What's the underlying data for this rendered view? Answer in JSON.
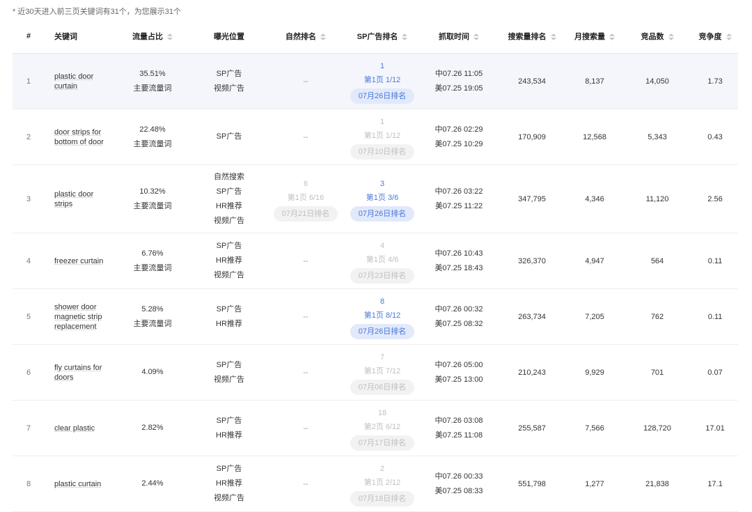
{
  "notice": "* 近30天进入前三页关键词有31个，为您展示31个",
  "headers": {
    "index": "#",
    "keyword": "关键词",
    "traffic": "流量占比",
    "exposure": "曝光位置",
    "natural": "自然排名",
    "sp": "SP广告排名",
    "time": "抓取时间",
    "search_rank": "搜索量排名",
    "monthly": "月搜索量",
    "competitors": "竞品数",
    "competition": "竞争度"
  },
  "rows": [
    {
      "index": "1",
      "keyword": "plastic door curtain",
      "traffic": "35.51%",
      "traffic_tag": "主要流量词",
      "exposure": [
        "SP广告",
        "视频广告"
      ],
      "natural": {
        "num": "--",
        "page": "",
        "badge": ""
      },
      "sp": {
        "num": "1",
        "page": "第1页 1/12",
        "badge": "07月26日排名",
        "active": true
      },
      "time_cn": "中07.26 11:05",
      "time_us": "美07.25 19:05",
      "search_rank": "243,534",
      "monthly": "8,137",
      "competitors": "14,050",
      "competition": "1.73"
    },
    {
      "index": "2",
      "keyword": "door strips for bottom of door",
      "traffic": "22.48%",
      "traffic_tag": "主要流量词",
      "exposure": [
        "SP广告"
      ],
      "natural": {
        "num": "--",
        "page": "",
        "badge": ""
      },
      "sp": {
        "num": "1",
        "page": "第1页 1/12",
        "badge": "07月10日排名",
        "active": false
      },
      "time_cn": "中07.26 02:29",
      "time_us": "美07.25 10:29",
      "search_rank": "170,909",
      "monthly": "12,568",
      "competitors": "5,343",
      "competition": "0.43"
    },
    {
      "index": "3",
      "keyword": "plastic door strips",
      "traffic": "10.32%",
      "traffic_tag": "主要流量词",
      "exposure": [
        "自然搜索",
        "SP广告",
        "HR推荐",
        "视频广告"
      ],
      "natural": {
        "num": "6",
        "page": "第1页 6/16",
        "badge": "07月21日排名",
        "active": false
      },
      "sp": {
        "num": "3",
        "page": "第1页 3/6",
        "badge": "07月26日排名",
        "active": true
      },
      "time_cn": "中07.26 03:22",
      "time_us": "美07.25 11:22",
      "search_rank": "347,795",
      "monthly": "4,346",
      "competitors": "11,120",
      "competition": "2.56"
    },
    {
      "index": "4",
      "keyword": "freezer curtain",
      "traffic": "6.76%",
      "traffic_tag": "主要流量词",
      "exposure": [
        "SP广告",
        "HR推荐",
        "视频广告"
      ],
      "natural": {
        "num": "--",
        "page": "",
        "badge": ""
      },
      "sp": {
        "num": "4",
        "page": "第1页 4/6",
        "badge": "07月23日排名",
        "active": false
      },
      "time_cn": "中07.26 10:43",
      "time_us": "美07.25 18:43",
      "search_rank": "326,370",
      "monthly": "4,947",
      "competitors": "564",
      "competition": "0.11"
    },
    {
      "index": "5",
      "keyword": "shower door magnetic strip replacement",
      "traffic": "5.28%",
      "traffic_tag": "主要流量词",
      "exposure": [
        "SP广告",
        "HR推荐"
      ],
      "natural": {
        "num": "--",
        "page": "",
        "badge": ""
      },
      "sp": {
        "num": "8",
        "page": "第1页 8/12",
        "badge": "07月26日排名",
        "active": true
      },
      "time_cn": "中07.26 00:32",
      "time_us": "美07.25 08:32",
      "search_rank": "263,734",
      "monthly": "7,205",
      "competitors": "762",
      "competition": "0.11"
    },
    {
      "index": "6",
      "keyword": "fly curtains for doors",
      "traffic": "4.09%",
      "traffic_tag": "",
      "exposure": [
        "SP广告",
        "视频广告"
      ],
      "natural": {
        "num": "--",
        "page": "",
        "badge": ""
      },
      "sp": {
        "num": "7",
        "page": "第1页 7/12",
        "badge": "07月06日排名",
        "active": false
      },
      "time_cn": "中07.26 05:00",
      "time_us": "美07.25 13:00",
      "search_rank": "210,243",
      "monthly": "9,929",
      "competitors": "701",
      "competition": "0.07"
    },
    {
      "index": "7",
      "keyword": "clear plastic",
      "traffic": "2.82%",
      "traffic_tag": "",
      "exposure": [
        "SP广告",
        "HR推荐"
      ],
      "natural": {
        "num": "--",
        "page": "",
        "badge": ""
      },
      "sp": {
        "num": "18",
        "page": "第2页 6/12",
        "badge": "07月17日排名",
        "active": false
      },
      "time_cn": "中07.26 03:08",
      "time_us": "美07.25 11:08",
      "search_rank": "255,587",
      "monthly": "7,566",
      "competitors": "128,720",
      "competition": "17.01"
    },
    {
      "index": "8",
      "keyword": "plastic curtain",
      "traffic": "2.44%",
      "traffic_tag": "",
      "exposure": [
        "SP广告",
        "HR推荐",
        "视频广告"
      ],
      "natural": {
        "num": "--",
        "page": "",
        "badge": ""
      },
      "sp": {
        "num": "2",
        "page": "第1页 2/12",
        "badge": "07月18日排名",
        "active": false
      },
      "time_cn": "中07.26 00:33",
      "time_us": "美07.25 08:33",
      "search_rank": "551,798",
      "monthly": "1,277",
      "competitors": "21,838",
      "competition": "17.1"
    }
  ]
}
